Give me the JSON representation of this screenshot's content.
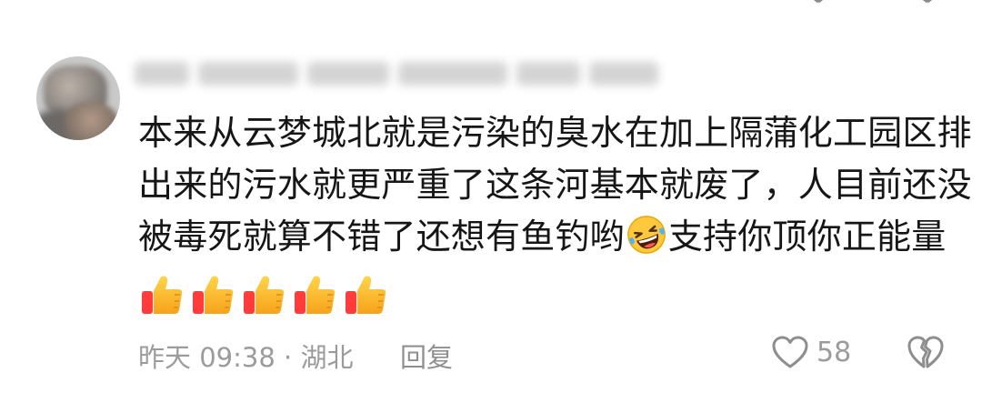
{
  "comment": {
    "lines": [
      "本来从云梦城北就是污染的臭水在加上隔蒲化工园区排",
      "出来的污水就更严重了这条河基本就废了，人目前还没",
      "被毒死就算不错了还想有鱼钓哟",
      "支持你顶你正能量"
    ],
    "inline_emoji_icon": "rolling-on-floor-laughing-icon",
    "reaction_emojis": [
      "thumbs-up-icon",
      "thumbs-up-icon",
      "thumbs-up-icon",
      "thumbs-up-icon",
      "thumbs-up-icon"
    ]
  },
  "footer": {
    "meta": "昨天 09:38 · 湖北",
    "reply_label": "回复",
    "like_count": "58",
    "like_icon": "heart-outline-icon",
    "dislike_icon": "broken-heart-icon"
  },
  "colors": {
    "text": "#161616",
    "muted": "#9b9b9b",
    "background": "#ffffff"
  }
}
